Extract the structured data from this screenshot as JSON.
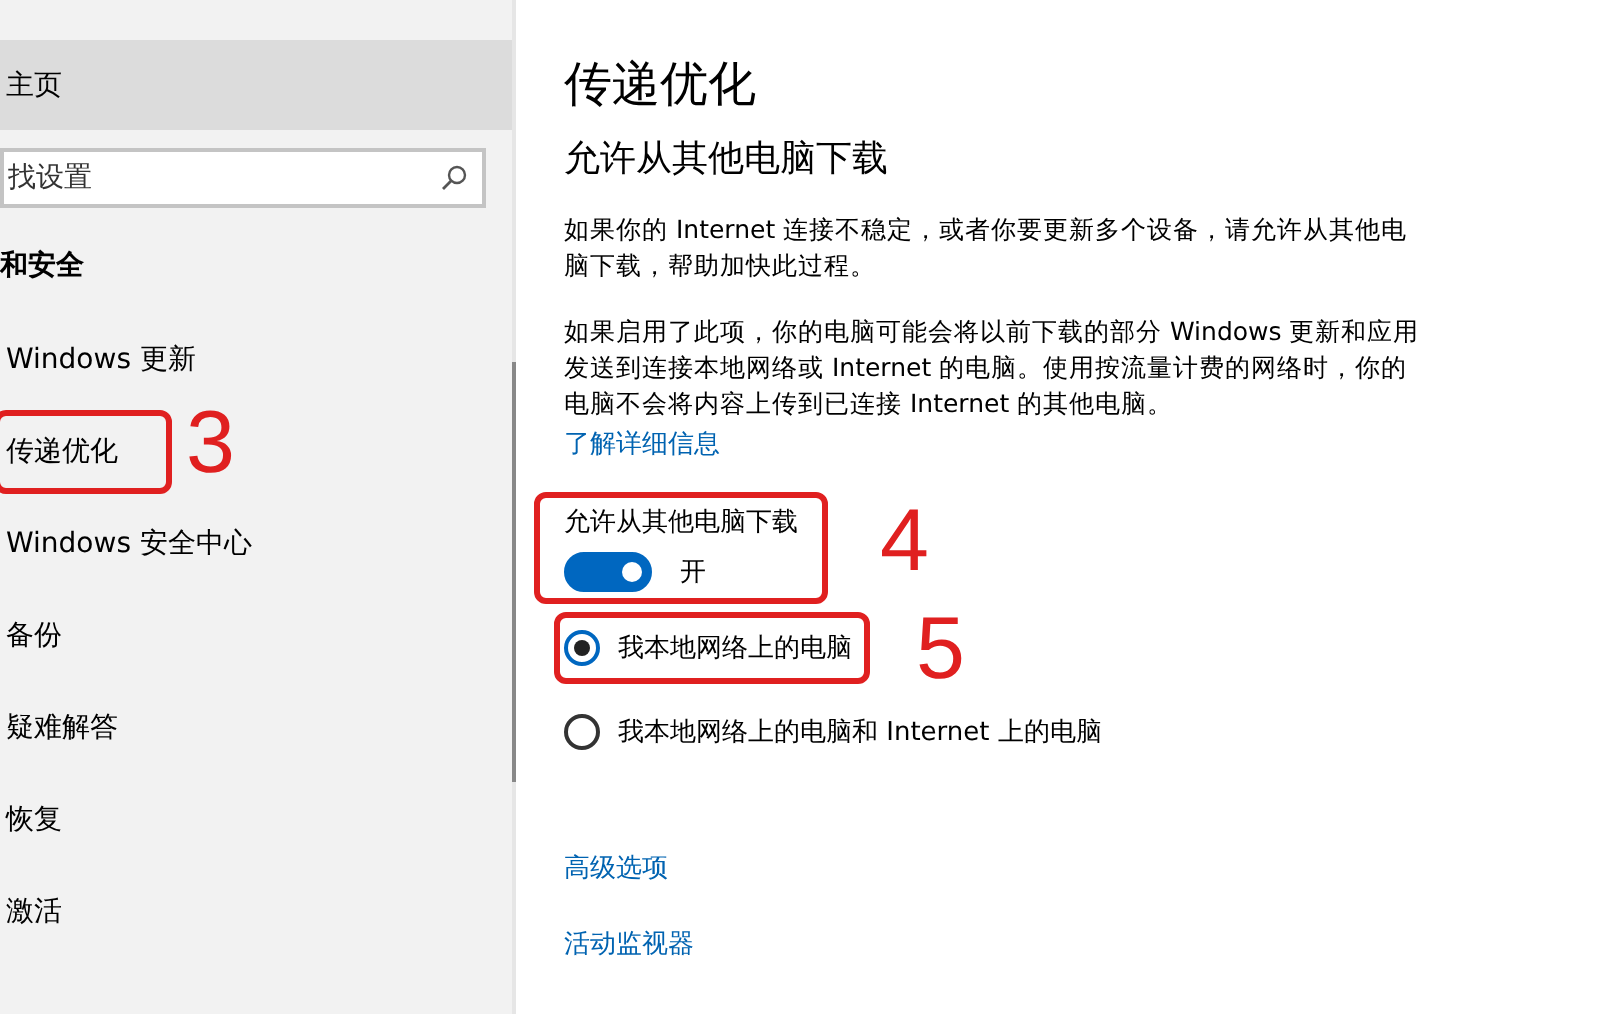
{
  "sidebar": {
    "home": {
      "label": "主页"
    },
    "search": {
      "placeholder": "找设置"
    },
    "section": "和安全",
    "items": [
      {
        "label": "Windows 更新"
      },
      {
        "label": "传递优化",
        "callout": "3"
      },
      {
        "label": "Windows 安全中心"
      },
      {
        "label": "备份"
      },
      {
        "label": "疑难解答"
      },
      {
        "label": "恢复"
      },
      {
        "label": "激活"
      }
    ]
  },
  "page": {
    "title": "传递优化",
    "subtitle": "允许从其他电脑下载",
    "paragraphs": [
      "如果你的 Internet 连接不稳定，或者你要更新多个设备，请允许从其他电脑下载，帮助加快此过程。",
      "如果启用了此项，你的电脑可能会将以前下载的部分 Windows 更新和应用发送到连接本地网络或 Internet 的电脑。使用按流量计费的网络时，你的电脑不会将内容上传到已连接 Internet 的其他电脑。"
    ],
    "learn_more": "了解详细信息",
    "toggle": {
      "label": "允许从其他电脑下载",
      "on": true,
      "state_text": "开",
      "callout": "4"
    },
    "options": [
      {
        "label": "我本地网络上的电脑",
        "selected": true,
        "callout": "5"
      },
      {
        "label": "我本地网络上的电脑和 Internet 上的电脑",
        "selected": false
      }
    ],
    "links": [
      "高级选项",
      "活动监视器"
    ]
  }
}
